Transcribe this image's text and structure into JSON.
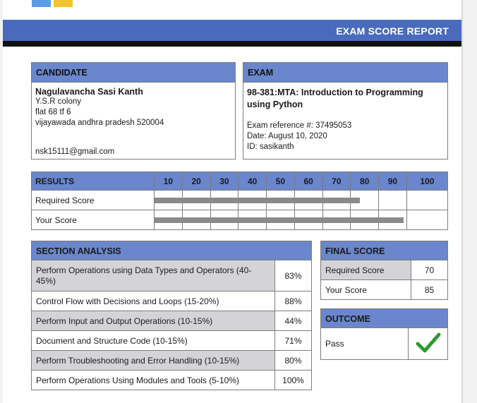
{
  "report_title": "EXAM SCORE REPORT",
  "candidate": {
    "heading": "CANDIDATE",
    "name": "Nagulavancha Sasi Kanth",
    "address_line1": "Y.S.R colony",
    "address_line2": "flat 68 tf 6",
    "address_line3": "vijayawada andhra pradesh 520004",
    "email": "nsk15111@gmail.com"
  },
  "exam": {
    "heading": "EXAM",
    "title": "98-381:MTA: Introduction to Programming using Python",
    "reference": "Exam reference #: 37495053",
    "date": "Date: August 10, 2020",
    "id": "ID: sasikanth"
  },
  "results": {
    "heading": "RESULTS",
    "scale": [
      "10",
      "20",
      "30",
      "40",
      "50",
      "60",
      "70",
      "80",
      "90",
      "100"
    ],
    "rows": [
      {
        "label": "Required Score",
        "value": 70
      },
      {
        "label": "Your Score",
        "value": 85
      }
    ]
  },
  "section_analysis": {
    "heading": "SECTION ANALYSIS",
    "rows": [
      {
        "name": "Perform Operations using Data Types and Operators (40-45%)",
        "pct": "83%"
      },
      {
        "name": "Control Flow with Decisions and Loops (15-20%)",
        "pct": "88%"
      },
      {
        "name": "Perform Input and Output Operations (10-15%)",
        "pct": "44%"
      },
      {
        "name": "Document and Structure Code (10-15%)",
        "pct": "71%"
      },
      {
        "name": "Perform Troubleshooting and Error Handling (10-15%)",
        "pct": "80%"
      },
      {
        "name": "Perform Operations Using Modules and Tools (5-10%)",
        "pct": "100%"
      }
    ]
  },
  "final_score": {
    "heading": "FINAL SCORE",
    "required_label": "Required Score",
    "required_value": "70",
    "your_label": "Your Score",
    "your_value": "85"
  },
  "outcome": {
    "heading": "OUTCOME",
    "result": "Pass",
    "icon": "checkmark-icon",
    "check_color": "#2e9a2e"
  }
}
